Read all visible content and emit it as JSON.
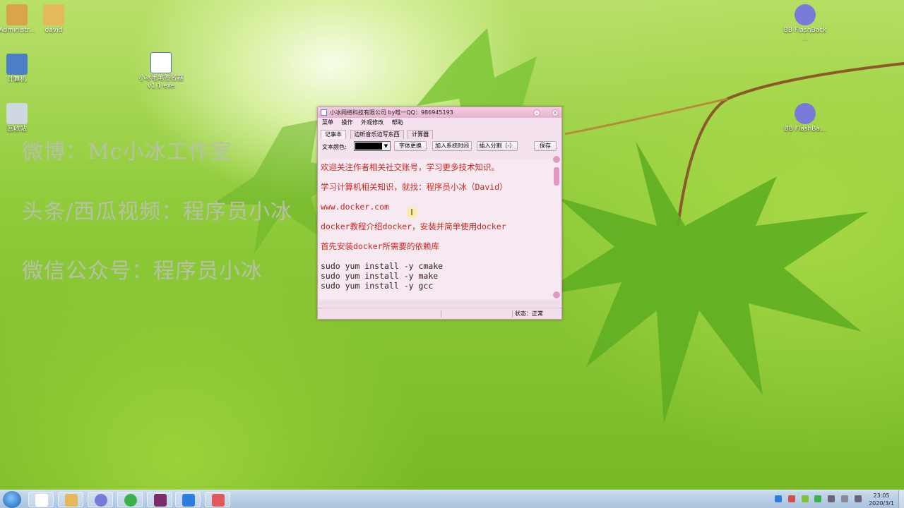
{
  "desktop": {
    "icons": [
      {
        "label": "Administr...",
        "color": "#d9a54a"
      },
      {
        "label": "david",
        "color": "#e3b95a"
      },
      {
        "label": "计算机",
        "color": "#4d7fc7"
      },
      {
        "label": "小冰毛笔签名器 v1.1.exe",
        "color": "#ffffff"
      },
      {
        "label": "回收站",
        "color": "#cfd8e0"
      },
      {
        "label": "BB FlashBack ...",
        "color": "#7a7ad9"
      },
      {
        "label": "BB FlashBa...",
        "color": "#7a7ad9"
      }
    ],
    "overlay": [
      "微博：Mc小冰工作室",
      "头条/西瓜视频：程序员小冰",
      "微信公众号：程序员小冰"
    ]
  },
  "window": {
    "title": "小冰网络科技有限公司 by唯一QQ：986945193",
    "menu": [
      "菜单",
      "操作",
      "外观修改",
      "帮助"
    ],
    "tabs": [
      "记事本",
      "边听音乐边写东西",
      "计算器"
    ],
    "toolbar": {
      "color_label": "文本颜色:",
      "selected_color": "#000000",
      "font_button": "字体更换",
      "time_button": "加入系统时间",
      "split_button": "插入分割（-）",
      "save_button": "保存"
    },
    "content": {
      "red_lines": [
        "欢迎关注作者相关社交账号，学习更多技术知识。",
        "学习计算机相关知识，就找：程序员小冰（David）",
        "www.docker.com",
        "docker教程介绍docker，安装并简单使用docker",
        "首先安装docker所需要的依赖库"
      ],
      "code_lines": [
        "sudo yum install -y cmake",
        "sudo yum install -y  make",
        "sudo yum install -y gcc"
      ]
    },
    "status": "状态：正常"
  },
  "taskbar": {
    "clock_time": "23:05",
    "clock_date": "2020/3/1"
  }
}
